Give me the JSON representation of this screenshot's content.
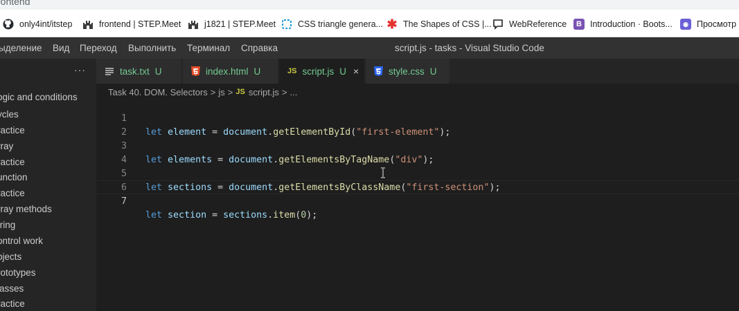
{
  "browser": {
    "title_fragment": "rontend",
    "bookmarks": [
      {
        "label": "only4int/itstep",
        "icon": "github-icon"
      },
      {
        "label": "frontend | STEP.Meet",
        "icon": "castle-icon"
      },
      {
        "label": "j1821 | STEP.Meet",
        "icon": "castle-icon"
      },
      {
        "label": "CSS triangle genera...",
        "icon": "triangle-gen-icon"
      },
      {
        "label": "The Shapes of CSS |...",
        "icon": "asterisk-icon"
      },
      {
        "label": "WebReference",
        "icon": "chat-icon"
      },
      {
        "label": "Introduction · Boots...",
        "icon": "bootstrap-icon"
      },
      {
        "label": "Просмотр г",
        "icon": "viewer-icon"
      }
    ]
  },
  "menubar": {
    "items": [
      "ыделение",
      "Вид",
      "Переход",
      "Выполнить",
      "Терминал",
      "Справка"
    ],
    "window_title": "script.js - tasks - Visual Studio Code"
  },
  "sidebar": {
    "more": "···",
    "items": [
      "ogic and conditions",
      "ycles",
      "ractice",
      "rray",
      "ractice",
      "unction",
      "ractice",
      "rray methods",
      "tring",
      "ontrol work",
      "bjects",
      "rototypes",
      "lasses",
      "ractice"
    ]
  },
  "tabs": [
    {
      "label": "task.txt",
      "status": "U",
      "icon": "text-file-icon"
    },
    {
      "label": "index.html",
      "status": "U",
      "icon": "html5-icon"
    },
    {
      "label": "script.js",
      "status": "U",
      "icon": "js-icon",
      "close": "×"
    },
    {
      "label": "style.css",
      "status": "U",
      "icon": "css3-icon"
    }
  ],
  "breadcrumb": {
    "parts": [
      "Task 40. DOM. Selectors",
      "js",
      "script.js",
      "..."
    ],
    "separator": ">",
    "js_badge": "JS"
  },
  "editor": {
    "line_numbers": [
      "1",
      "2",
      "3",
      "4",
      "5",
      "6",
      "7"
    ],
    "lines": [
      {
        "let": "let",
        "name": "element",
        "eq": "=",
        "obj": "document",
        "method": "getElementById",
        "arg": "\"first-element\"",
        "end": ");"
      },
      {},
      {
        "let": "let",
        "name": "elements",
        "eq": "=",
        "obj": "document",
        "method": "getElementsByTagName",
        "arg": "\"div\"",
        "end": ");"
      },
      {},
      {
        "let": "let",
        "name": "sections",
        "eq": "=",
        "obj": "document",
        "method": "getElementsByClassName",
        "arg": "\"first-section\"",
        "end": ");"
      },
      {},
      {
        "let": "let",
        "name": "section",
        "eq": "=",
        "obj": "sections",
        "method": "item",
        "arg": "0",
        "end": ");"
      }
    ]
  },
  "colors": {
    "keyword": "#569cd6",
    "variable": "#9cdcfe",
    "function": "#dcdcaa",
    "string": "#ce9178",
    "number": "#b5cea8",
    "git_untracked": "#73c991",
    "editor_bg": "#1e1e1e",
    "sidebar_bg": "#252526"
  }
}
